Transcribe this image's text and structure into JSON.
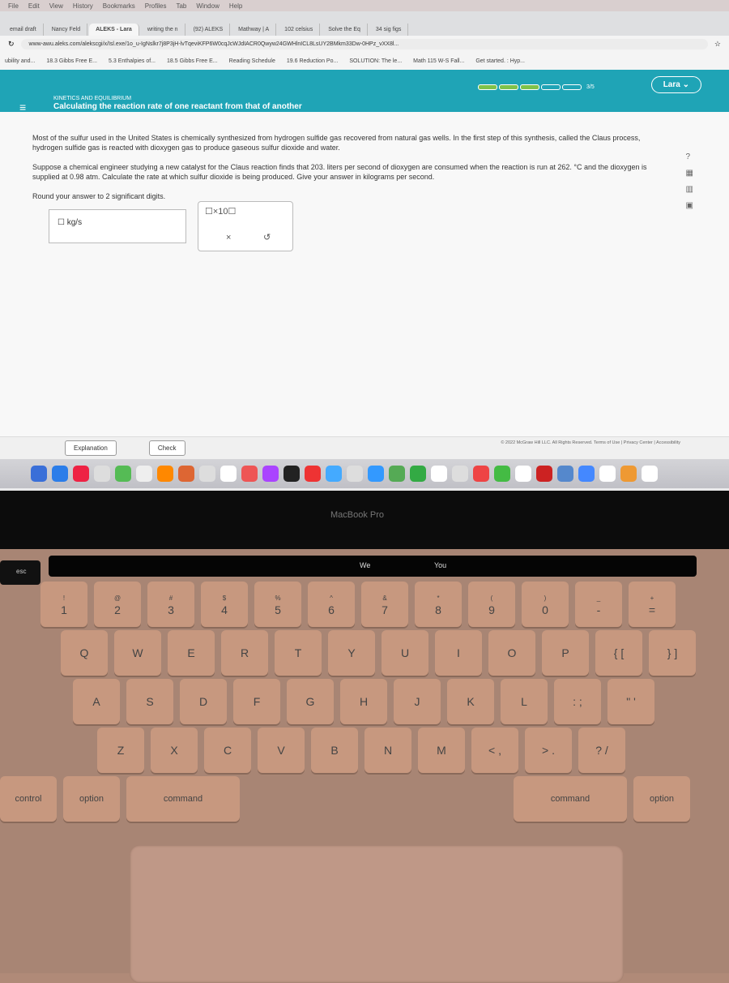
{
  "menubar": [
    "File",
    "Edit",
    "View",
    "History",
    "Bookmarks",
    "Profiles",
    "Tab",
    "Window",
    "Help"
  ],
  "tabs": [
    "email draft",
    "Nancy Feld",
    "ALEKS - Lara",
    "writing the n",
    "(92) ALEKS",
    "Mathway | A",
    "102 celsius",
    "Solve the Eq",
    "34 sig figs"
  ],
  "url": "www-awu.aleks.com/alekscgi/x/Isl.exe/1o_u-IgNslkr7j8P3jH-lvTqeviKFP6W0cqJcWJdIACR0Qwyw24GWHlnICL8LsUY2BMkm33Dw-0HPz_vXX8l...",
  "bookmarks": [
    "ubility and...",
    "18.3 Gibbs Free E...",
    "5.3 Enthalpies of...",
    "18.5 Gibbs Free E...",
    "Reading Schedule",
    "19.6 Reduction Po...",
    "SOLUTION: The le...",
    "Math 115 W-S Fall...",
    "Get started. : Hyp..."
  ],
  "aleks": {
    "topic": "KINETICS AND EQUILIBRIUM",
    "subtitle": "Calculating the reaction rate of one reactant from that of another",
    "progress": {
      "completed": 3,
      "total": 5,
      "label": "3/5"
    },
    "user": "Lara",
    "para1": "Most of the sulfur used in the United States is chemically synthesized from hydrogen sulfide gas recovered from natural gas wells. In the first step of this synthesis, called the Claus process, hydrogen sulfide gas is reacted with dioxygen gas to produce gaseous sulfur dioxide and water.",
    "para2": "Suppose a chemical engineer studying a new catalyst for the Claus reaction finds that 203. liters per second of dioxygen are consumed when the reaction is run at 262. °C and the dioxygen is supplied at 0.98 atm. Calculate the rate at which sulfur dioxide is being produced. Give your answer in kilograms per second.",
    "para3": "Round your answer to 2 significant digits.",
    "unit": "kg/s",
    "clear": "×",
    "undo": "↺",
    "help": "?",
    "explanation": "Explanation",
    "check": "Check",
    "footer": "© 2022 McGraw Hill LLC. All Rights Reserved.   Terms of Use  |  Privacy Center  |  Accessibility"
  },
  "laptop": {
    "model": "MacBook Pro",
    "esc": "esc",
    "touchbar": [
      "We",
      "You"
    ]
  },
  "keys": {
    "row1": [
      [
        "!",
        "1"
      ],
      [
        "@",
        "2"
      ],
      [
        "#",
        "3"
      ],
      [
        "$",
        "4"
      ],
      [
        "%",
        "5"
      ],
      [
        "^",
        "6"
      ],
      [
        "&",
        "7"
      ],
      [
        "*",
        "8"
      ],
      [
        "(",
        "9"
      ],
      [
        ")",
        "0"
      ],
      [
        "_",
        "-"
      ],
      [
        "+",
        "="
      ]
    ],
    "row2": [
      "Q",
      "W",
      "E",
      "R",
      "T",
      "Y",
      "U",
      "I",
      "O",
      "P",
      "{ [",
      "} ]"
    ],
    "row3": [
      "A",
      "S",
      "D",
      "F",
      "G",
      "H",
      "J",
      "K",
      "L",
      ": ;",
      "\" '"
    ],
    "row4": [
      "Z",
      "X",
      "C",
      "V",
      "B",
      "N",
      "M",
      "< ,",
      "> .",
      "? /"
    ],
    "row5": [
      "control",
      "option",
      "command",
      "command",
      "option"
    ]
  }
}
